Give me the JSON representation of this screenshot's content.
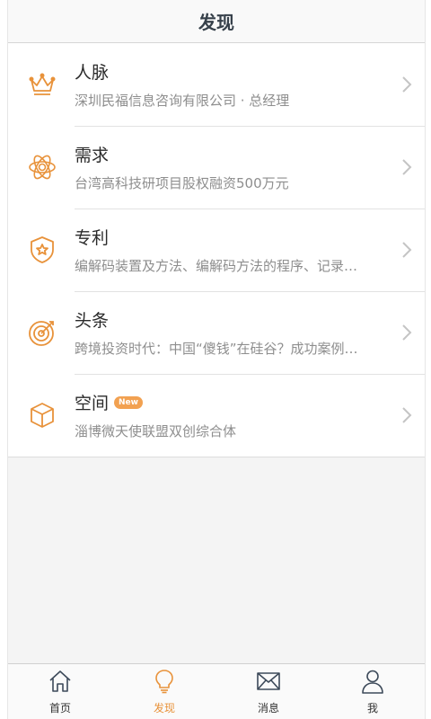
{
  "nav": {
    "title": "发现"
  },
  "items": [
    {
      "icon": "crown-icon",
      "title": "人脉",
      "subtitle": "深圳民福信息咨询有限公司 · 总经理"
    },
    {
      "icon": "atom-icon",
      "title": "需求",
      "subtitle": "台湾高科技研项目股权融资500万元"
    },
    {
      "icon": "shield-star-icon",
      "title": "专利",
      "subtitle": "编解码装置及方法、编解码方法的程序、记录…"
    },
    {
      "icon": "target-icon",
      "title": "头条",
      "subtitle": "跨境投资时代：中国“傻钱”在硅谷？成功案例…"
    },
    {
      "icon": "cube-icon",
      "title": "空间",
      "badge": "New",
      "subtitle": "淄博微天使联盟双创综合体"
    }
  ],
  "tabbar": [
    {
      "icon": "home-icon",
      "label": "首页",
      "active": false
    },
    {
      "icon": "lightbulb-icon",
      "label": "发现",
      "active": true
    },
    {
      "icon": "envelope-icon",
      "label": "消息",
      "active": false
    },
    {
      "icon": "person-icon",
      "label": "我",
      "active": false
    }
  ],
  "colors": {
    "accent": "#e8923a",
    "badge": "#f2a151",
    "tab_icon": "#3d4a5a"
  }
}
